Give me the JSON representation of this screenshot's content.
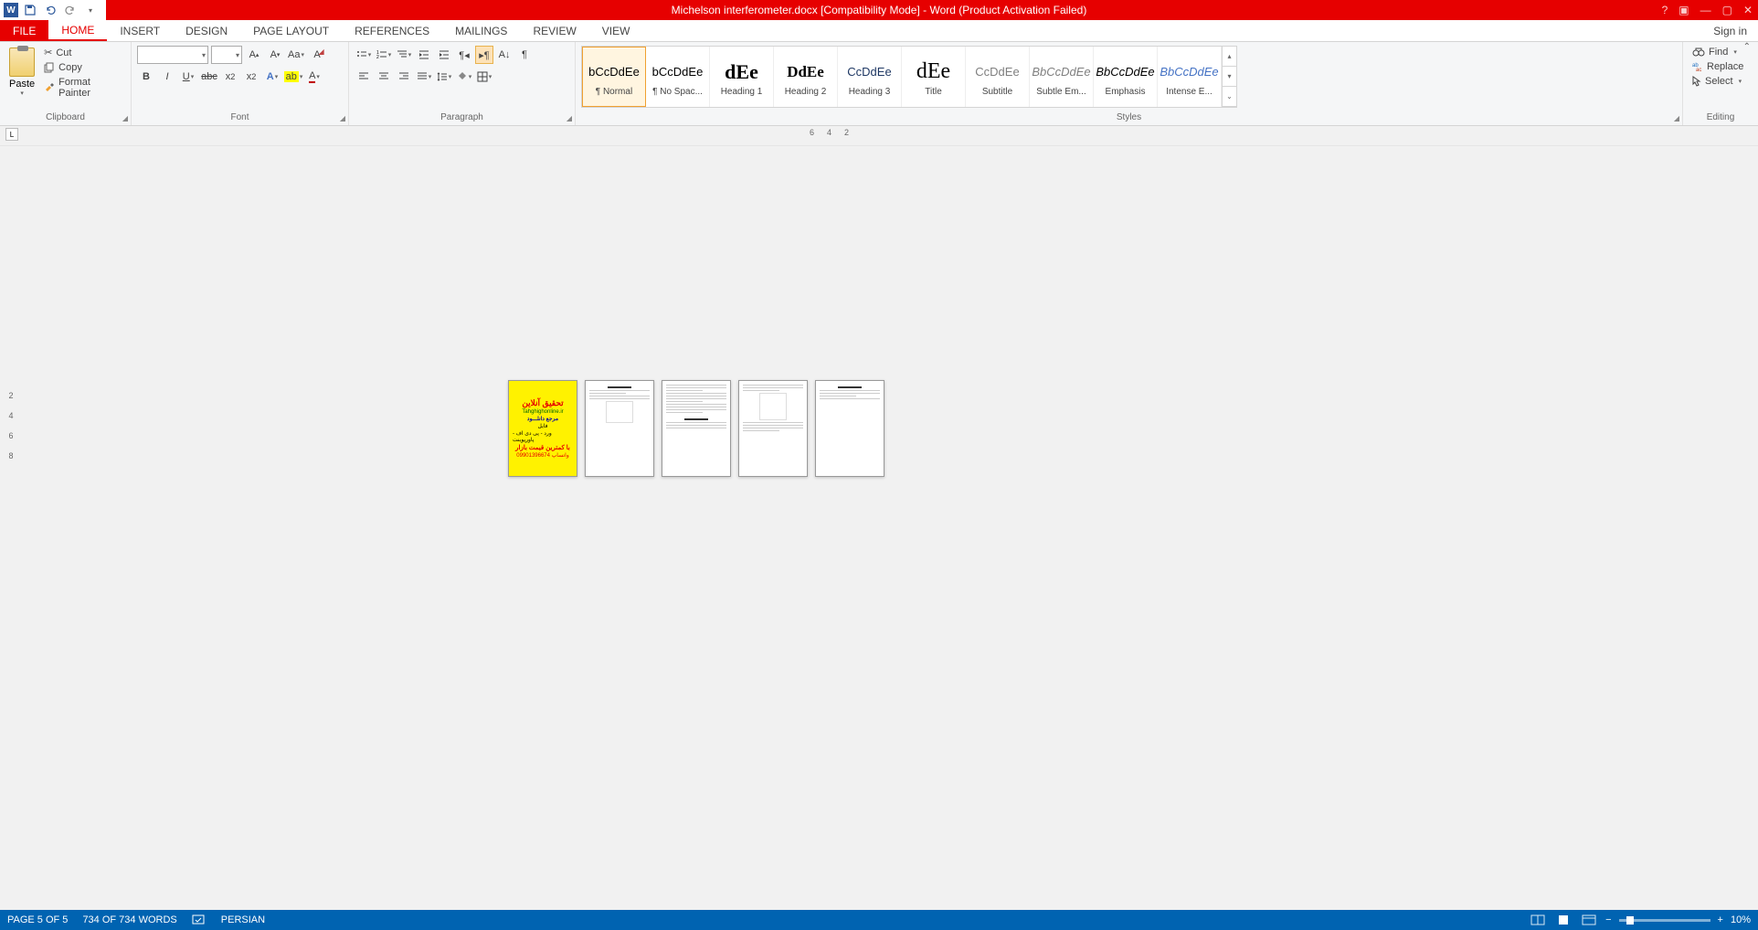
{
  "titlebar": {
    "title": "Michelson interferometer.docx [Compatibility Mode] - Word (Product Activation Failed)",
    "app_letter": "W"
  },
  "tabs": {
    "file": "FILE",
    "home": "HOME",
    "insert": "INSERT",
    "design": "DESIGN",
    "page_layout": "PAGE LAYOUT",
    "references": "REFERENCES",
    "mailings": "MAILINGS",
    "review": "REVIEW",
    "view": "VIEW",
    "signin": "Sign in"
  },
  "clipboard": {
    "paste": "Paste",
    "cut": "Cut",
    "copy": "Copy",
    "format_painter": "Format Painter",
    "group": "Clipboard"
  },
  "font": {
    "name": "",
    "size": "",
    "group": "Font"
  },
  "paragraph": {
    "group": "Paragraph"
  },
  "styles_group": "Styles",
  "styles": [
    {
      "preview": "bCcDdEe",
      "label": "¶ Normal",
      "color": "#000"
    },
    {
      "preview": "bCcDdEe",
      "label": "¶ No Spac...",
      "color": "#000"
    },
    {
      "preview": "dEe",
      "label": "Heading 1",
      "color": "#000",
      "big": true
    },
    {
      "preview": "DdEe",
      "label": "Heading 2",
      "color": "#000"
    },
    {
      "preview": "CcDdEe",
      "label": "Heading 3",
      "color": "#1f3864"
    },
    {
      "preview": "dEe",
      "label": "Title",
      "color": "#000",
      "big": true
    },
    {
      "preview": "CcDdEe",
      "label": "Subtitle",
      "color": "#7f7f7f"
    },
    {
      "preview": "BbCcDdEe",
      "label": "Subtle Em...",
      "color": "#7f7f7f"
    },
    {
      "preview": "BbCcDdEe",
      "label": "Emphasis",
      "color": "#000"
    },
    {
      "preview": "BbCcDdEe",
      "label": "Intense E...",
      "color": "#4472c4"
    }
  ],
  "editing": {
    "find": "Find",
    "replace": "Replace",
    "select": "Select",
    "group": "Editing"
  },
  "ruler_h": [
    "6",
    "4",
    "2"
  ],
  "ruler_v": [
    "2",
    "4",
    "6",
    "8"
  ],
  "status": {
    "page": "PAGE 5 OF 5",
    "words": "734 OF 734 WORDS",
    "language": "PERSIAN",
    "zoom": "10%"
  },
  "cover_page": {
    "l1": "تحقیق آنلاین",
    "l2": "Tahghighonline.ir",
    "l3": "مرجع دانلـــود",
    "l4a": "فایل",
    "l4b": "ورد - پی دی اف - پاورپوینت",
    "l5": "با کمترین قیمت بازار",
    "l6": "واتساپ 09901396674"
  }
}
